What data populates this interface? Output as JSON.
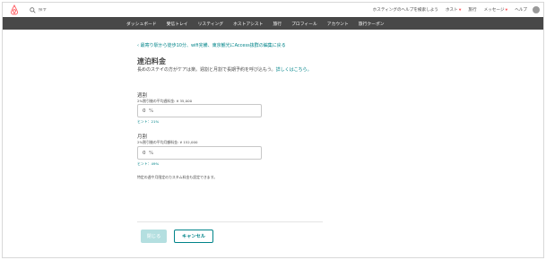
{
  "header": {
    "search_placeholder": "探す",
    "links": [
      {
        "label": "ホスティングのヘルプを検索しよう",
        "caret": false
      },
      {
        "label": "ホスト",
        "caret": true
      },
      {
        "label": "旅行",
        "caret": false
      },
      {
        "label": "メッセージ",
        "caret": true
      },
      {
        "label": "ヘルプ",
        "caret": false
      }
    ]
  },
  "nav": {
    "items": [
      "ダッシュボード",
      "受信トレイ",
      "リスティング",
      "ホストアシスト",
      "旅行",
      "プロフィール",
      "アカウント",
      "旅行クーポン"
    ]
  },
  "main": {
    "back_link": "最寄り駅から徒歩10分、wifi完備、東京観光にAccess抜群の編集に戻る",
    "title": "連泊料金",
    "description": "長めのステイの方がケアは楽。週割と月割で長期予約を呼び込もう。",
    "description_link": "詳しくはこちら。",
    "weekly": {
      "label": "週割",
      "sub": "2%割引後の平均週料金: ¥ 35,000",
      "value": "0",
      "unit": "%",
      "hint": "ヒント：21%"
    },
    "monthly": {
      "label": "月割",
      "sub": "2%割引後の平均月額料金: ¥ 152,000",
      "value": "0",
      "unit": "%",
      "hint": "ヒント：49%"
    },
    "note": "特定の週や月限定のカスタム料金も設定できます。",
    "close_label": "閉じる",
    "cancel_label": "キャンセル"
  },
  "colors": {
    "accent": "#008489",
    "nav_bg": "#484848",
    "brand": "#ff5a5f",
    "close_btn": "#b4dfe0"
  },
  "icons": {
    "logo": "airbnb-logo-icon",
    "search": "search-icon",
    "back": "chevron-left-icon"
  }
}
